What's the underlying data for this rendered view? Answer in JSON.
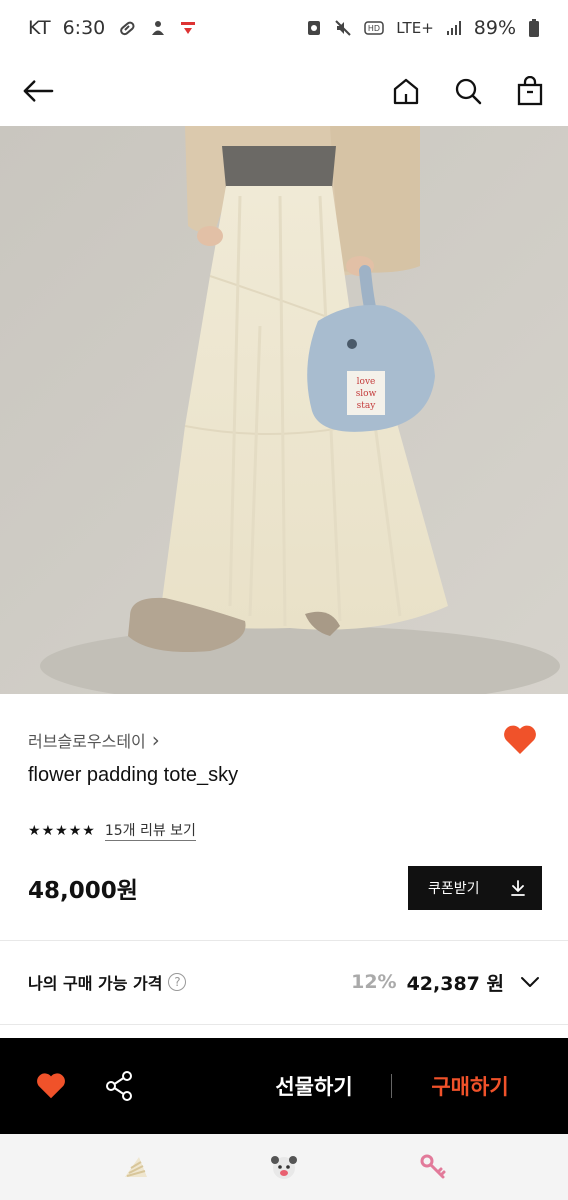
{
  "status_bar": {
    "carrier": "KT",
    "time": "6:30",
    "network": "LTE+",
    "battery": "89%"
  },
  "header": {
    "back_icon": "back-arrow-icon",
    "home_icon": "home-icon",
    "search_icon": "search-icon",
    "cart_icon": "shopping-bag-icon"
  },
  "hero": {
    "bag_label": [
      "love",
      "slow",
      "stay"
    ]
  },
  "product": {
    "brand": "러브슬로우스테이",
    "brand_chevron": "›",
    "name": "flower padding tote_sky",
    "rating": 5,
    "review_link": "15개 리뷰 보기",
    "price": "48,000원",
    "coupon_label": "쿠폰받기"
  },
  "my_price": {
    "label": "나의 구매 가능 가격",
    "help": "?",
    "discount": "12%",
    "price": "42,387 원"
  },
  "purchase_bar": {
    "gift_label": "선물하기",
    "buy_label": "구매하기"
  },
  "colors": {
    "accent": "#f0522a",
    "dark": "#000000"
  }
}
